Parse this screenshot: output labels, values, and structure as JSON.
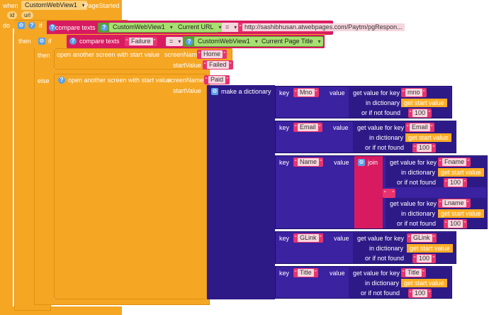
{
  "event": {
    "when_label": "when",
    "component": "CustomWebView1",
    "event_name": ".PageStarted",
    "params": [
      "id",
      "url"
    ],
    "do_label": "do"
  },
  "outer_if": {
    "if_label": "if",
    "compare_label": "compare texts",
    "left_component": "CustomWebView1",
    "left_property": "Current URL",
    "operator": "=",
    "right_text": "http://sashibhusan.atwebpages.com/Paytm/pgRespon...",
    "then_label": "then"
  },
  "inner_if": {
    "if_label": "if",
    "compare_label": "compare texts",
    "left_text": "Failure",
    "operator": "=",
    "right_component": "CustomWebView1",
    "right_property": "Current Page Title",
    "then_label": "then",
    "else_label": "else"
  },
  "then_action": {
    "label": "open another screen with start value",
    "screen_label": "screenName",
    "screen_value": "Home",
    "start_label": "startValue",
    "start_value": "Failed"
  },
  "else_action": {
    "label": "open another screen with start value",
    "screen_label": "screenName",
    "screen_value": "Paid",
    "start_label": "startValue",
    "dict_label": "make a dictionary"
  },
  "labels": {
    "key": "key",
    "value": "value",
    "get_value": "get value for key",
    "in_dictionary": "in dictionary",
    "or_if_not_found": "or if not found",
    "get_start_value": "get start value",
    "join": "join"
  },
  "pairs": [
    {
      "key": "Mno",
      "lookup": "mno",
      "default": "100"
    },
    {
      "key": "Email",
      "lookup": "Email",
      "default": "100"
    },
    {
      "key": "Name",
      "join": true,
      "lookup1": "Fname",
      "default1": "100",
      "separator": " ",
      "lookup2": "Lname",
      "default2": "100"
    },
    {
      "key": "GLink",
      "lookup": "GLink",
      "default": "100"
    },
    {
      "key": "Title",
      "lookup": "Title",
      "default": "100"
    }
  ]
}
